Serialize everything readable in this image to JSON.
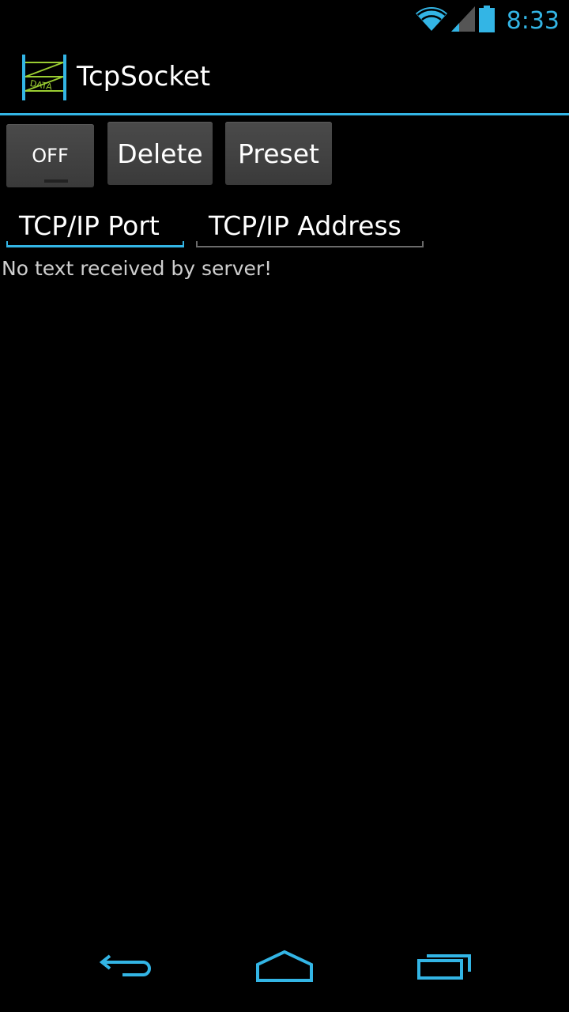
{
  "status_bar": {
    "time": "8:33",
    "icons": [
      "wifi-icon",
      "signal-icon",
      "battery-icon"
    ],
    "accent_color": "#33b5e5"
  },
  "action_bar": {
    "title": "TcpSocket",
    "icon": "data-app-icon",
    "icon_label": "DATA"
  },
  "controls": {
    "toggle_label": "OFF",
    "delete_label": "Delete",
    "preset_label": "Preset"
  },
  "fields": {
    "port_placeholder": "TCP/IP Port",
    "address_placeholder": "TCP/IP Address"
  },
  "output": {
    "message": "No text received by server!"
  },
  "nav_bar": {
    "buttons": [
      "back-icon",
      "home-icon",
      "recent-apps-icon"
    ]
  }
}
